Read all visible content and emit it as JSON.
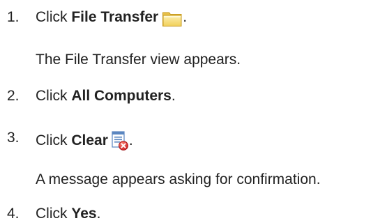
{
  "steps": [
    {
      "number": "1.",
      "prefix": "Click ",
      "bold": "File Transfer",
      "suffix": "",
      "icon": "folder-icon",
      "note": "The File Transfer view appears."
    },
    {
      "number": "2.",
      "prefix": "Click ",
      "bold": "All Computers",
      "suffix": "."
    },
    {
      "number": "3.",
      "prefix": "Click ",
      "bold": "Clear",
      "suffix": "",
      "icon": "clear-icon",
      "note": "A message appears asking for confirmation."
    },
    {
      "number": "4.",
      "prefix": "Click ",
      "bold": "Yes",
      "suffix": "."
    }
  ],
  "icon_end_punct": "."
}
